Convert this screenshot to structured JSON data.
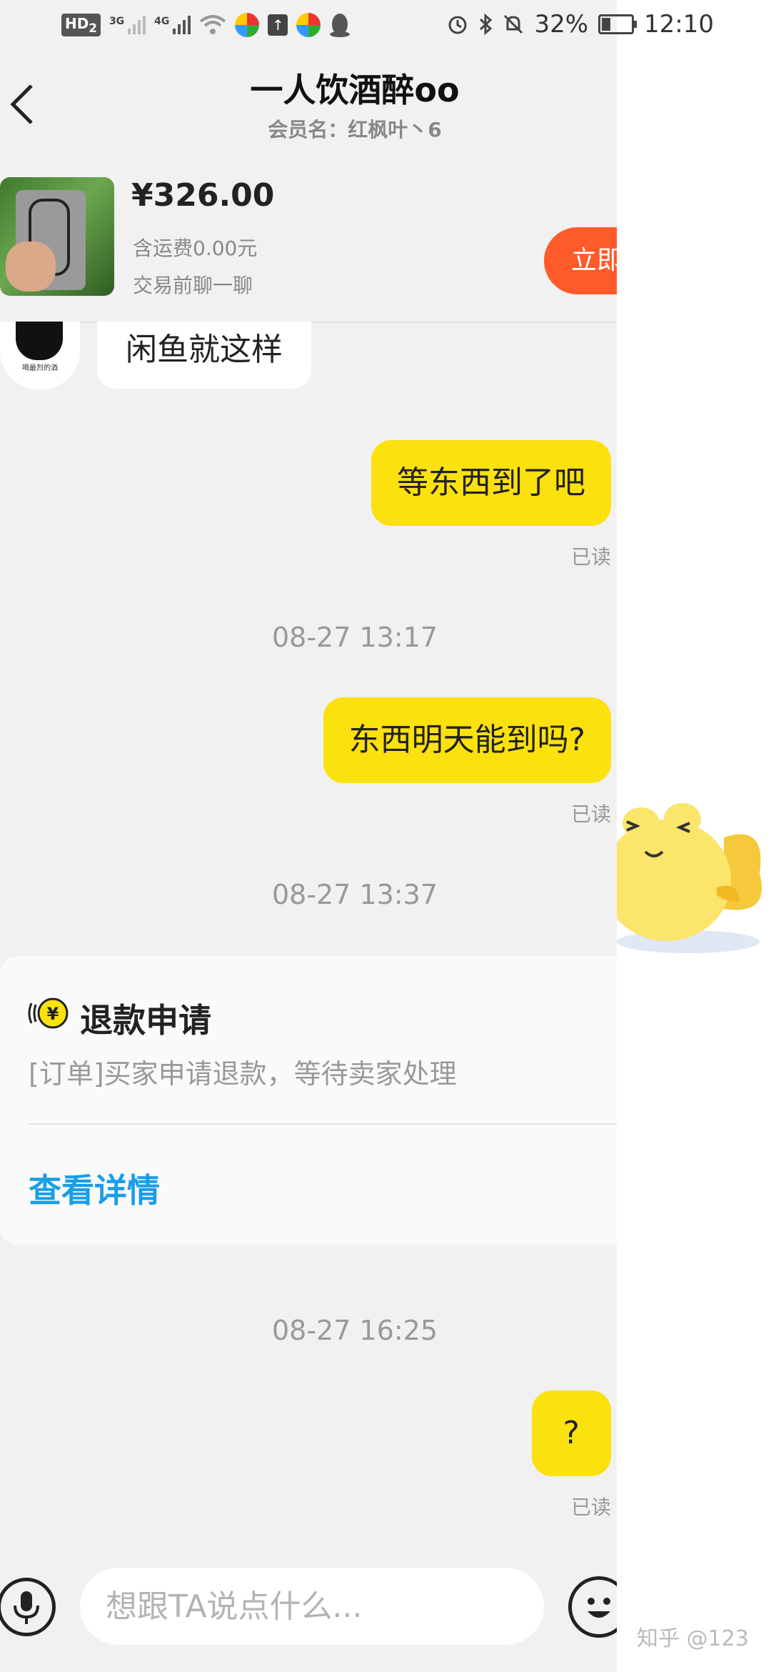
{
  "status_bar": {
    "hd_badge": "HD",
    "hd_sub": "2",
    "net1": "3G",
    "net2": "4G",
    "battery": "32%",
    "time": "12:10"
  },
  "header": {
    "title": "一人饮酒醉oo",
    "subtitle": "会员名：红枫叶丶6"
  },
  "product": {
    "price": "¥326.00",
    "shipping": "含运费0.00元",
    "chat_hint": "交易前聊一聊",
    "buy_label": "立即"
  },
  "messages": {
    "left_1": {
      "avatar_caption": "喝最烈的酒",
      "text": "闲鱼就这样"
    },
    "right_1": {
      "text": "等东西到了吧",
      "status": "已读"
    },
    "time_1": "08-27 13:17",
    "right_2": {
      "text": "东西明天能到吗?",
      "status": "已读"
    },
    "time_2": "08-27 13:37",
    "refund": {
      "icon_glyph": "¥",
      "title": "退款申请",
      "desc": "[订单]买家申请退款，等待卖家处理",
      "link": "查看详情"
    },
    "time_3": "08-27 16:25",
    "right_3": {
      "text": "?",
      "status": "已读"
    }
  },
  "input": {
    "placeholder": "想跟TA说点什么..."
  },
  "watermark": "知乎 @123",
  "colors": {
    "accent_yellow": "#fbe10e",
    "buy_orange": "#ff5a2a",
    "link_blue": "#1a9ee6",
    "chat_bg": "#f1f1f1"
  }
}
